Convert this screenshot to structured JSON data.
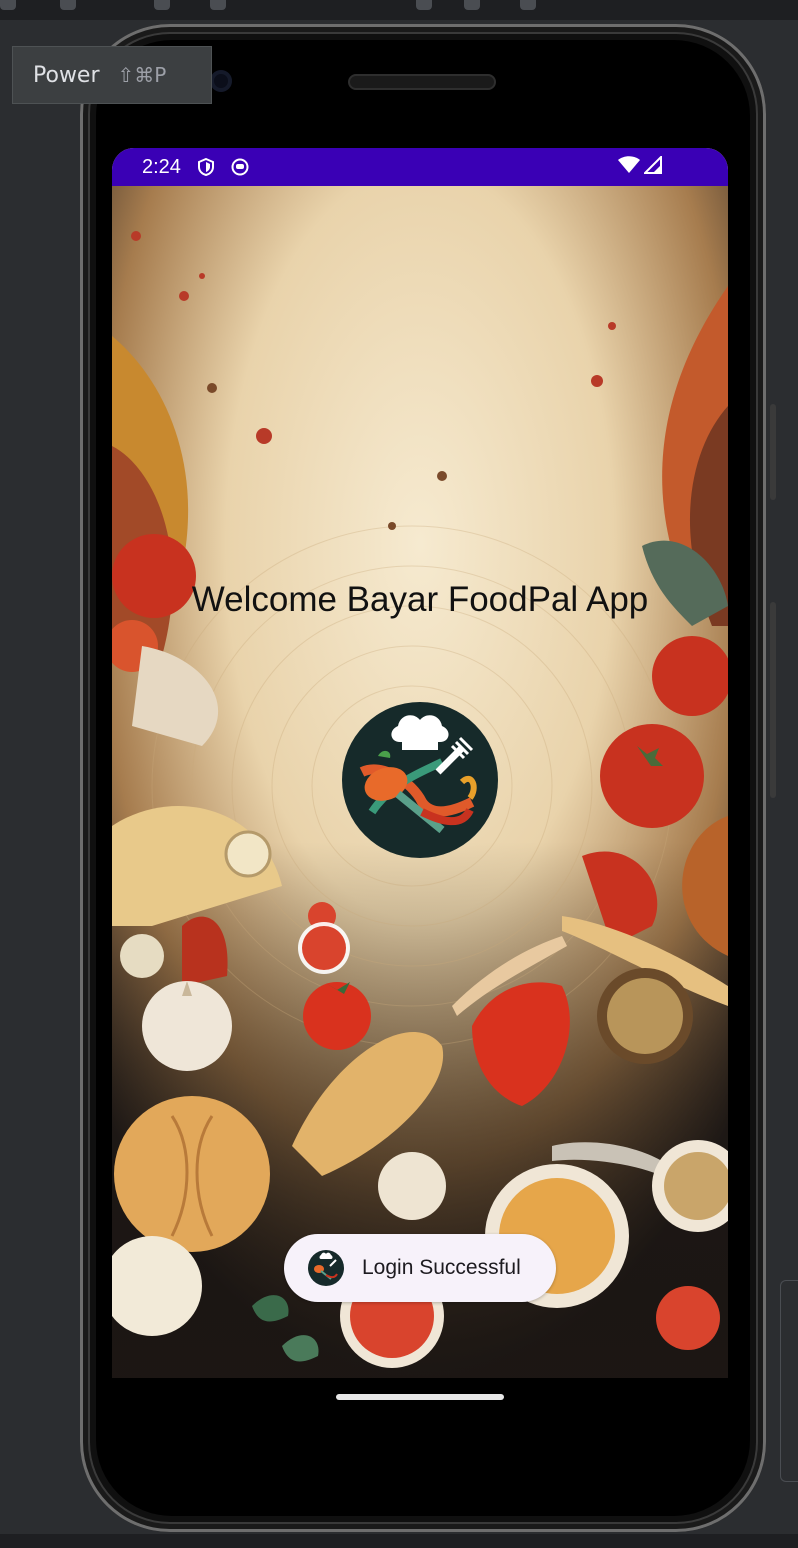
{
  "tooltip": {
    "label": "Power",
    "shortcut": "⇧⌘P"
  },
  "status_bar": {
    "time": "2:24",
    "background": "#3a00b5",
    "left_icons": [
      "shield-icon",
      "app-notification-icon"
    ],
    "right_icons": [
      "wifi-icon",
      "cellular-signal-icon"
    ]
  },
  "app": {
    "welcome_text": "Welcome Bayar FoodPal App",
    "logo": "chef-hat-spoon-fork-logo"
  },
  "toast": {
    "message": "Login Successful",
    "icon": "app-logo-icon"
  },
  "colors": {
    "status_bar": "#3a00b5",
    "toast_bg": "#f7f2fa",
    "ide_bg": "#2b2d30"
  }
}
